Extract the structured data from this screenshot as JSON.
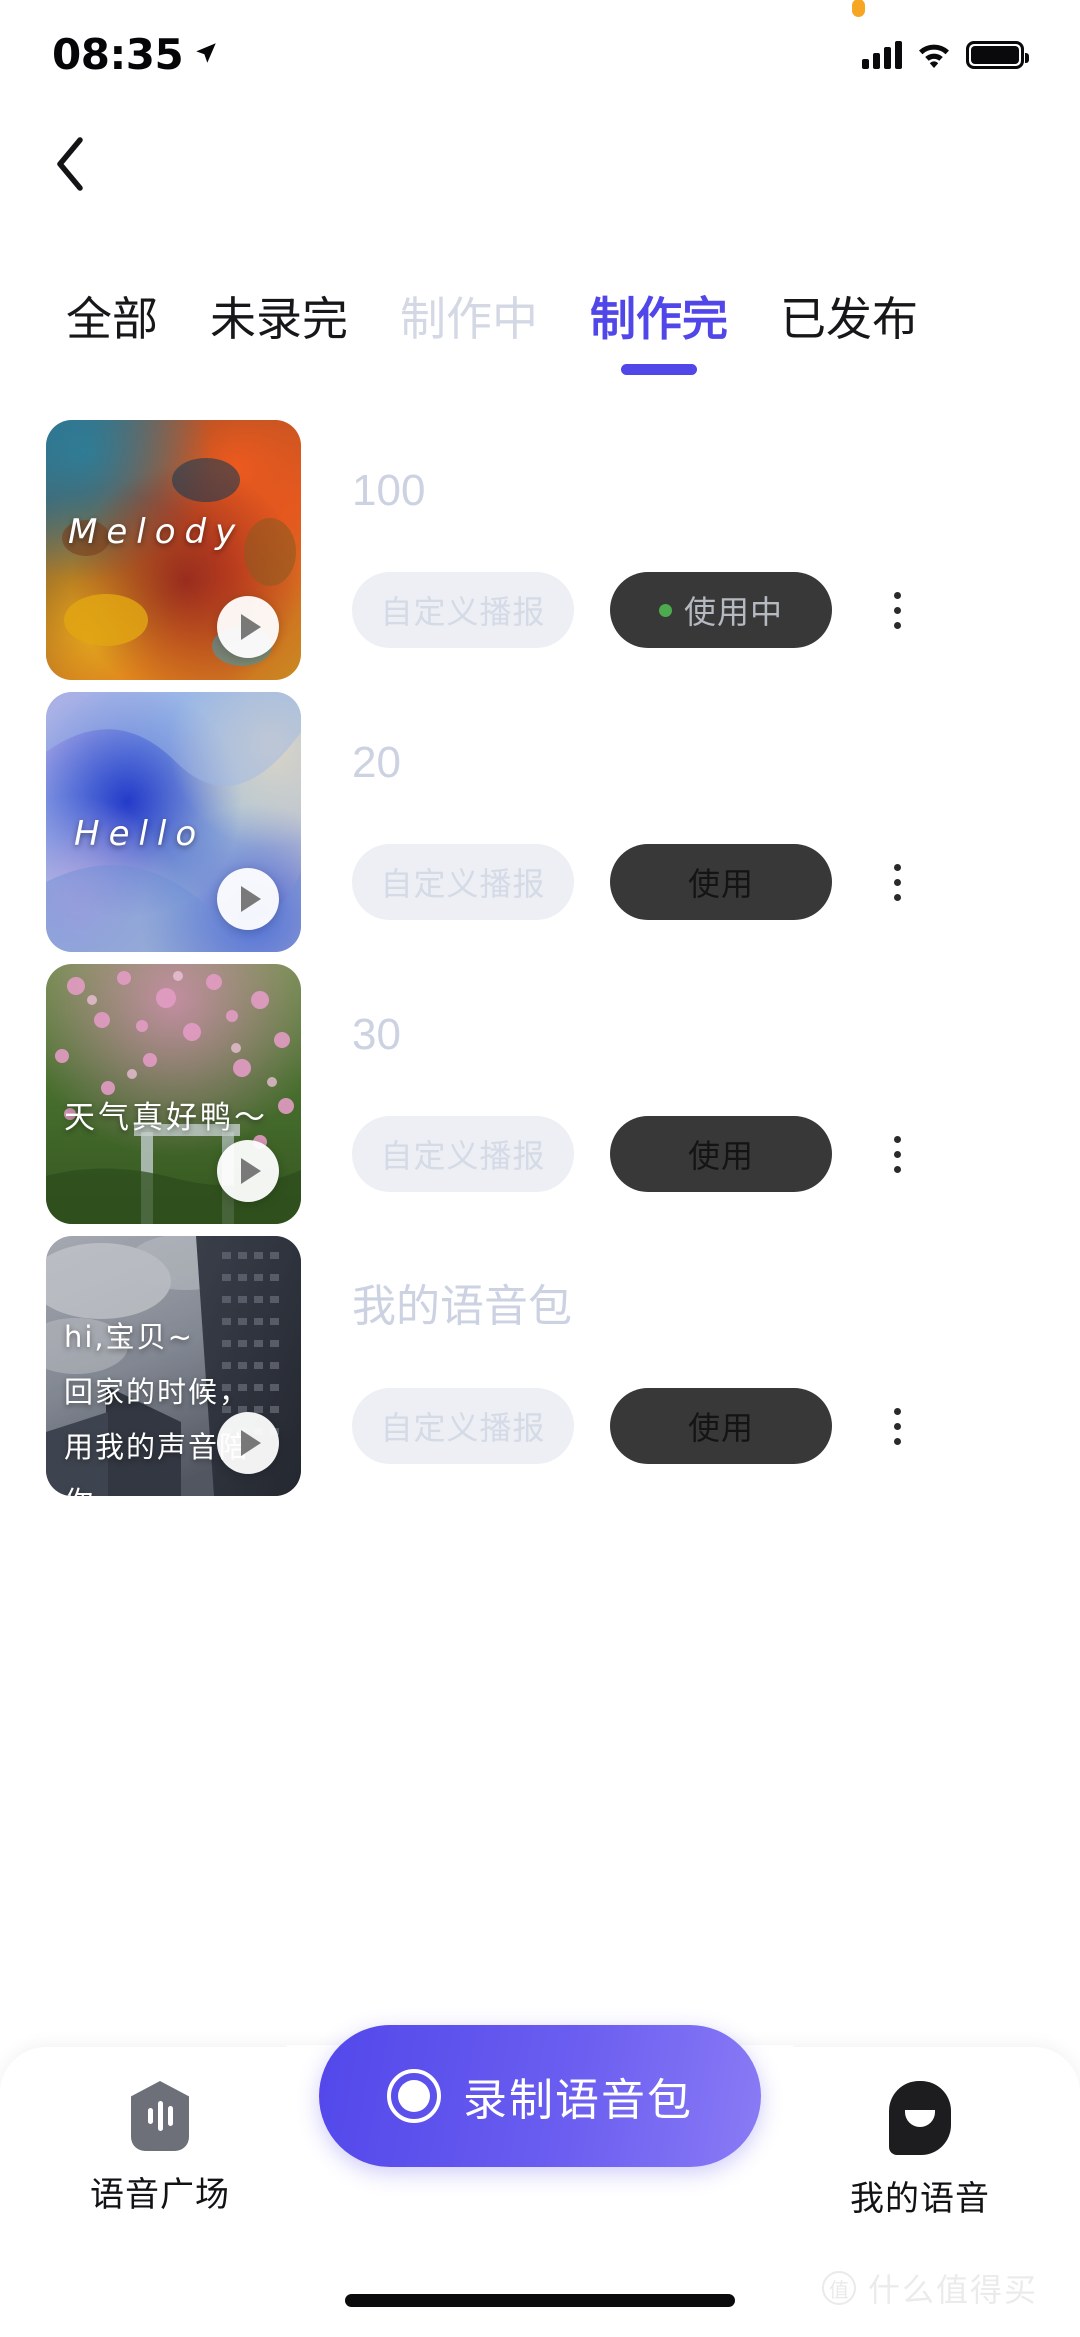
{
  "status_bar": {
    "time": "08:35",
    "location_icon": "location-arrow-icon",
    "signal_icon": "cellular-signal-icon",
    "wifi_icon": "wifi-icon",
    "battery_icon": "battery-full-icon",
    "recording_dot": "orange-status-dot"
  },
  "navbar": {
    "back_icon": "back-chevron-icon"
  },
  "tabs": [
    {
      "label": "全部",
      "state": "normal"
    },
    {
      "label": "未录完",
      "state": "normal"
    },
    {
      "label": "制作中",
      "state": "disabled"
    },
    {
      "label": "制作完",
      "state": "active"
    },
    {
      "label": "已发布",
      "state": "normal"
    }
  ],
  "colors": {
    "accent": "#5146e8",
    "tab_disabled": "#d3d8e4",
    "title_text": "#ccd2e2",
    "pill_light_bg": "#edeff4",
    "pill_light_text": "#d4dae6",
    "pill_dark_bg": "#383838",
    "in_use_text": "#b5b9c1",
    "in_use_dot": "#4eaa4e"
  },
  "list": [
    {
      "title": "100",
      "thumb_caption": "Melody",
      "thumb_style": "paint-palette",
      "custom_button": "自定义播报",
      "use_button": "使用中",
      "in_use": true,
      "play_icon": "play-icon",
      "more_icon": "more-vertical-icon"
    },
    {
      "title": "20",
      "thumb_caption": "Hello",
      "thumb_style": "blue-marble",
      "custom_button": "自定义播报",
      "use_button": "使用",
      "in_use": false,
      "play_icon": "play-icon",
      "more_icon": "more-vertical-icon"
    },
    {
      "title": "30",
      "thumb_caption": "天气真好鸭～",
      "thumb_style": "pink-flowers",
      "custom_button": "自定义播报",
      "use_button": "使用",
      "in_use": false,
      "play_icon": "play-icon",
      "more_icon": "more-vertical-icon"
    },
    {
      "title": "我的语音包",
      "thumb_caption": "hi,宝贝~\n回家的时候，\n用我的声音陪你。",
      "thumb_style": "city-buildings",
      "custom_button": "自定义播报",
      "use_button": "使用",
      "in_use": false,
      "play_icon": "play-icon",
      "more_icon": "more-vertical-icon"
    }
  ],
  "bottom_nav": {
    "left": {
      "label": "语音广场",
      "icon": "voice-plaza-icon"
    },
    "center": {
      "label": "录制语音包",
      "icon": "record-circle-icon"
    },
    "right": {
      "label": "我的语音",
      "icon": "my-voice-bubble-icon"
    }
  },
  "watermark": {
    "logo": "值",
    "text": "什么值得买"
  }
}
